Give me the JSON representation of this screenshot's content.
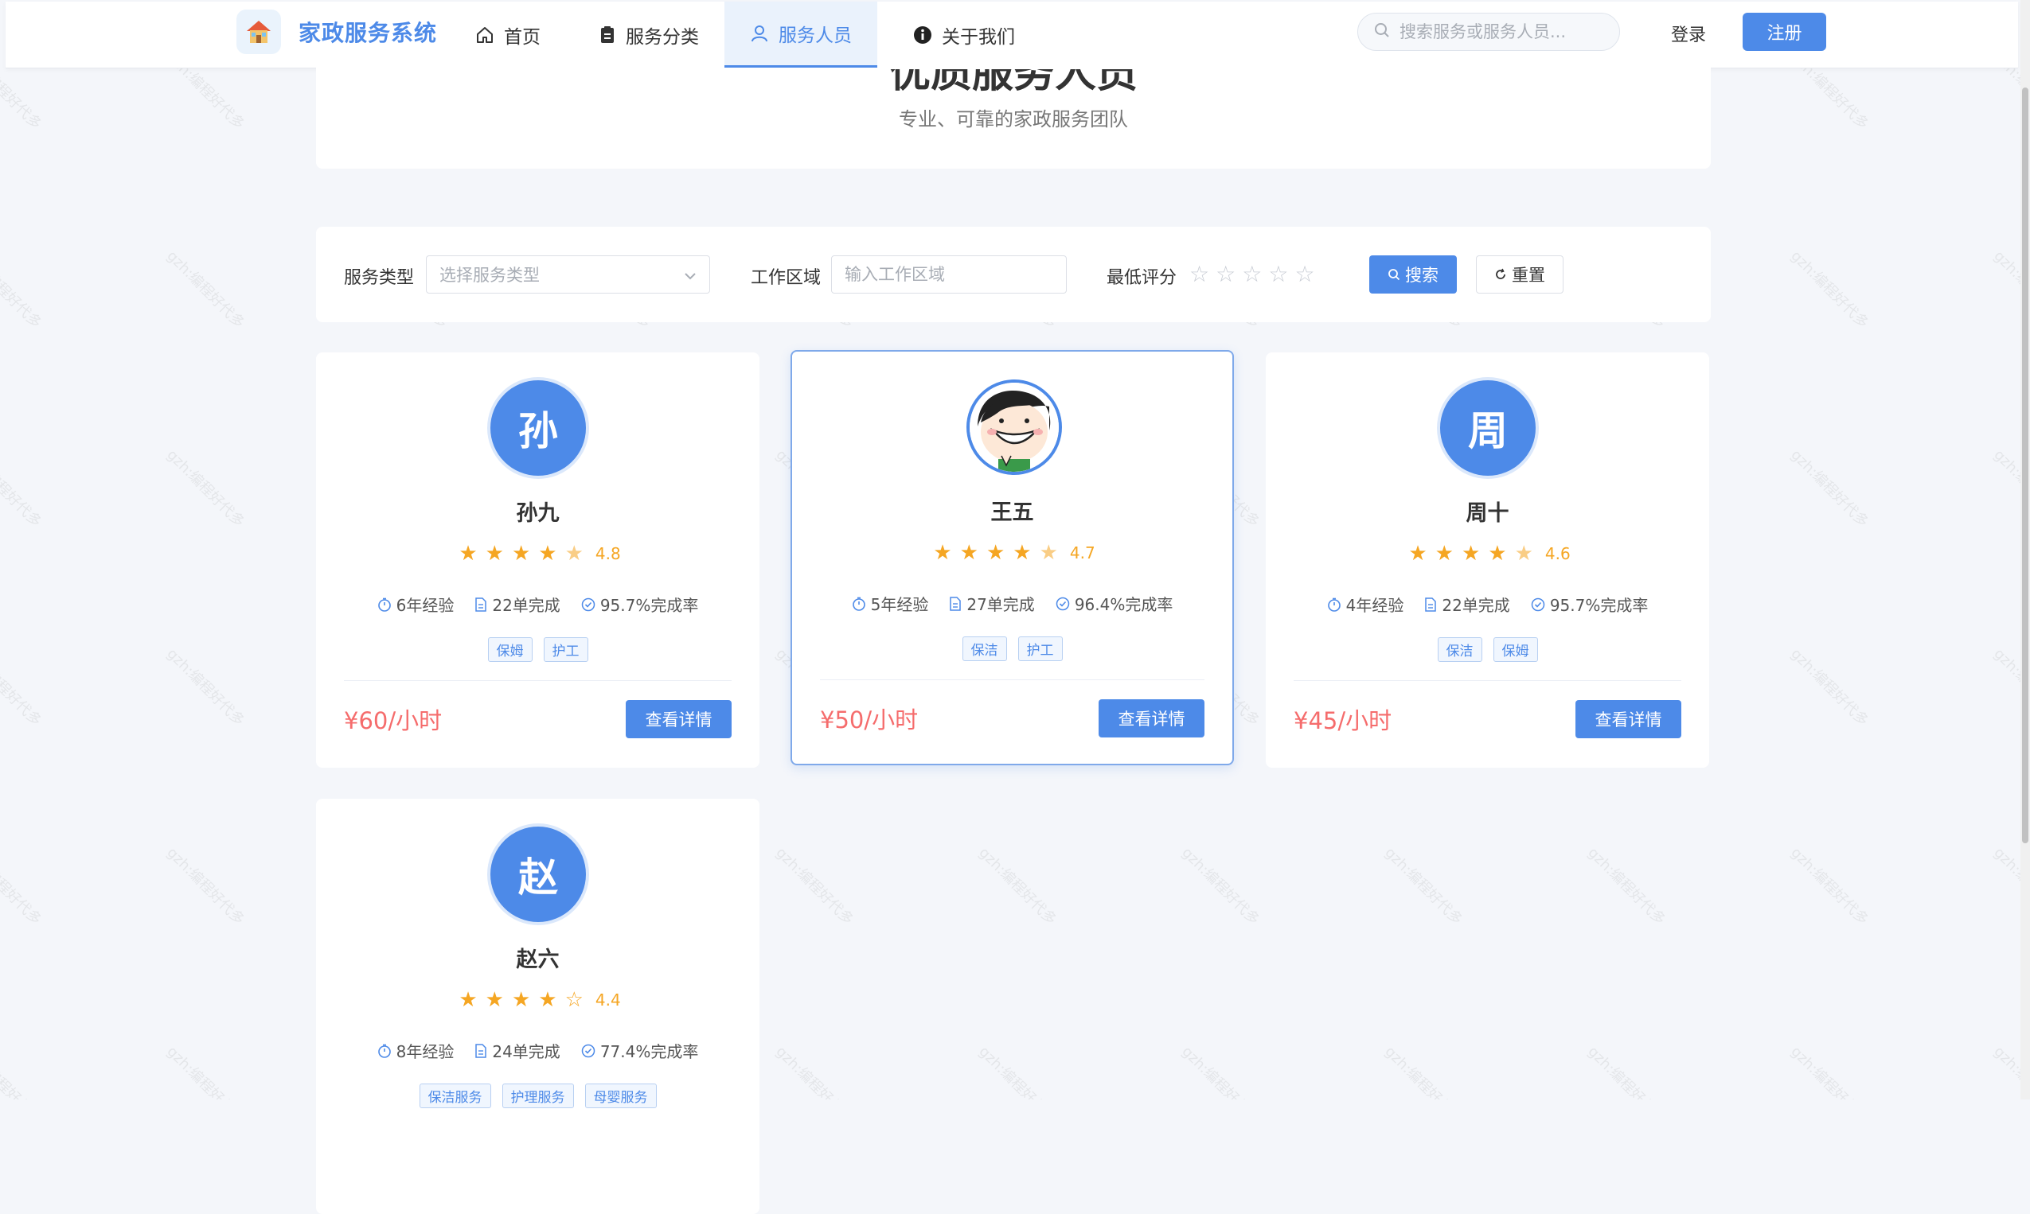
{
  "header": {
    "logo_text": "家政服务系统",
    "nav": [
      {
        "label": "首页",
        "icon": "home-icon"
      },
      {
        "label": "服务分类",
        "icon": "clipboard-icon"
      },
      {
        "label": "服务人员",
        "icon": "user-icon",
        "active": true
      },
      {
        "label": "关于我们",
        "icon": "info-icon"
      }
    ],
    "search_placeholder": "搜索服务或服务人员...",
    "login_label": "登录",
    "register_label": "注册"
  },
  "hero": {
    "title": "优质服务人员",
    "subtitle": "专业、可靠的家政服务团队"
  },
  "filter": {
    "service_type_label": "服务类型",
    "service_type_placeholder": "选择服务类型",
    "area_label": "工作区域",
    "area_placeholder": "输入工作区域",
    "min_rating_label": "最低评分",
    "min_rating_value": 0,
    "search_button": "搜索",
    "reset_button": "重置"
  },
  "workers": [
    {
      "avatar_char": "孙",
      "name": "孙九",
      "rating": "4.8",
      "experience": "6年经验",
      "orders": "22单完成",
      "completion": "95.7%完成率",
      "tags": [
        "保姆",
        "护工"
      ],
      "price": "¥60/小时",
      "detail_label": "查看详情"
    },
    {
      "avatar_char": "",
      "name": "王五",
      "rating": "4.7",
      "experience": "5年经验",
      "orders": "27单完成",
      "completion": "96.4%完成率",
      "tags": [
        "保洁",
        "护工"
      ],
      "price": "¥50/小时",
      "detail_label": "查看详情"
    },
    {
      "avatar_char": "周",
      "name": "周十",
      "rating": "4.6",
      "experience": "4年经验",
      "orders": "22单完成",
      "completion": "95.7%完成率",
      "tags": [
        "保洁",
        "保姆"
      ],
      "price": "¥45/小时",
      "detail_label": "查看详情"
    },
    {
      "avatar_char": "赵",
      "name": "赵六",
      "rating": "4.4",
      "experience": "8年经验",
      "orders": "24单完成",
      "completion": "77.4%完成率",
      "tags": [
        "保洁服务",
        "护理服务",
        "母婴服务"
      ],
      "price": "",
      "detail_label": ""
    }
  ],
  "colors": {
    "accent": "#4d8ae8",
    "price": "#f56c6c",
    "star": "#f5a623",
    "background": "#f4f6fa"
  }
}
